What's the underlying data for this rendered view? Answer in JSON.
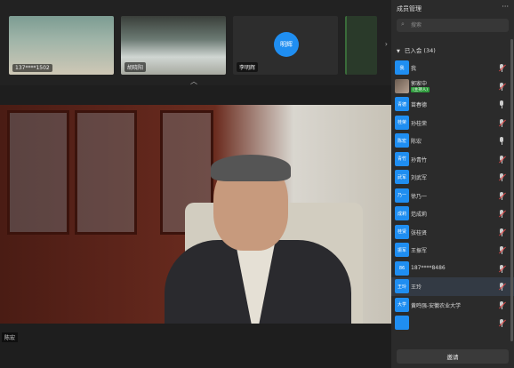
{
  "strip": {
    "thumbnails": [
      {
        "name": "137****1502"
      },
      {
        "name": "胡晓阳"
      },
      {
        "name": "李明辉",
        "avatar_text": "明辉"
      },
      {
        "name": ""
      }
    ]
  },
  "main_video": {
    "name": "陈宏"
  },
  "panel": {
    "title": "成员管理",
    "search_placeholder": "搜索",
    "group_label": "已入会 (34)",
    "invite_label": "邀请",
    "members": [
      {
        "avatar": "我",
        "name": "我",
        "mic": "muted"
      },
      {
        "avatar": "",
        "name": "郭家中",
        "sub": "(主持人)",
        "mic": "muted",
        "photo": true
      },
      {
        "avatar": "青德",
        "name": "苗春德",
        "mic": "on"
      },
      {
        "avatar": "桂荣",
        "name": "孙桂荣",
        "mic": "muted"
      },
      {
        "avatar": "陈宏",
        "name": "陈宏",
        "mic": "on"
      },
      {
        "avatar": "青竹",
        "name": "孙青竹",
        "mic": "muted"
      },
      {
        "avatar": "武军",
        "name": "刘武军",
        "mic": "muted"
      },
      {
        "avatar": "乃一",
        "name": "徐乃一",
        "mic": "muted"
      },
      {
        "avatar": "成莉",
        "name": "范成莉",
        "mic": "muted"
      },
      {
        "avatar": "桂贤",
        "name": "张桂贤",
        "mic": "muted"
      },
      {
        "avatar": "振军",
        "name": "王振军",
        "mic": "muted"
      },
      {
        "avatar": "86",
        "name": "187****8486",
        "mic": "muted"
      },
      {
        "avatar": "王玲",
        "name": "王玲",
        "mic": "muted",
        "selected": true
      },
      {
        "avatar": "大学",
        "name": "黄鸣强-安徽农业大学",
        "mic": "muted"
      },
      {
        "avatar": "",
        "name": "",
        "mic": "muted"
      }
    ]
  }
}
